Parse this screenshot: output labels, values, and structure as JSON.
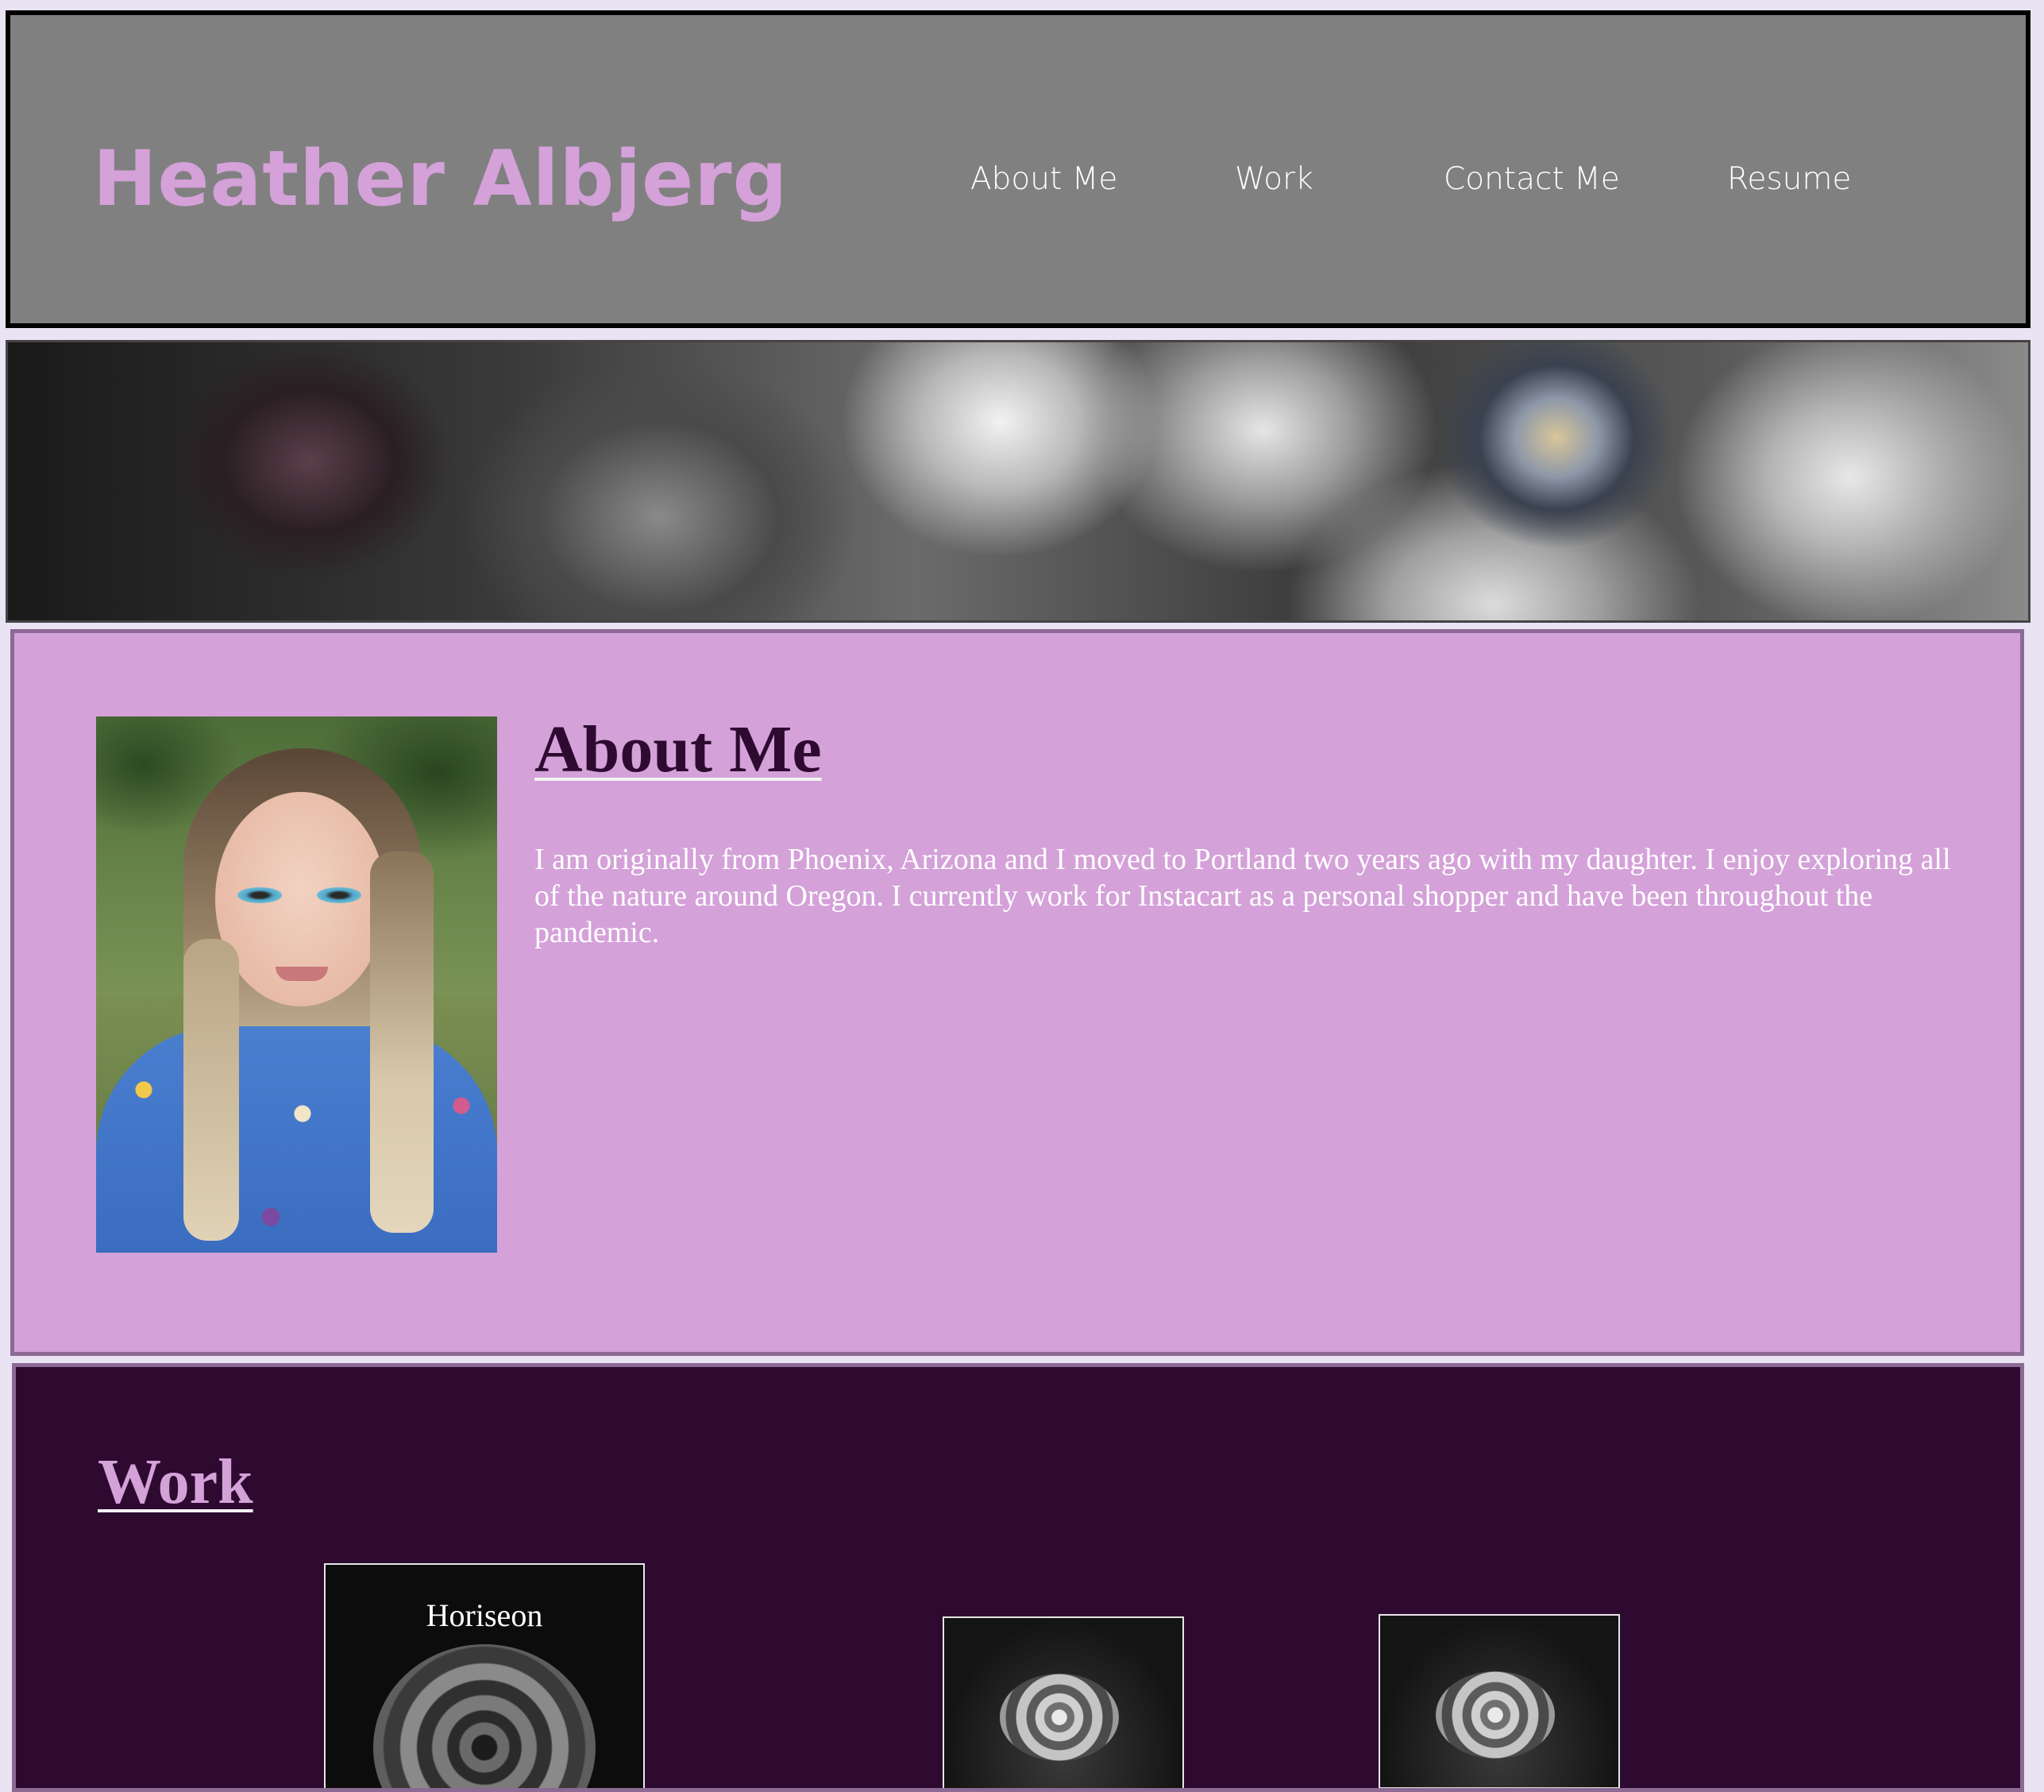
{
  "header": {
    "site_title": "Heather Albjerg",
    "nav": [
      {
        "label": "About Me"
      },
      {
        "label": "Work"
      },
      {
        "label": "Contact Me"
      },
      {
        "label": "Resume"
      }
    ]
  },
  "about": {
    "title": "About Me",
    "body": "I am originally from Phoenix, Arizona and I moved to Portland two years ago with my daughter. I enjoy exploring all of the nature around Oregon. I currently work for Instacart as a personal shopper and have been throughout the pandemic."
  },
  "work": {
    "title": "Work",
    "projects": [
      {
        "label": "Horiseon"
      }
    ]
  },
  "colors": {
    "header_bg": "#808080",
    "title_accent": "#d4a1d9",
    "about_bg": "#d4a1d9",
    "about_heading": "#2e0a31",
    "work_bg": "#2e0a31",
    "page_bg": "#e9e3f4"
  }
}
